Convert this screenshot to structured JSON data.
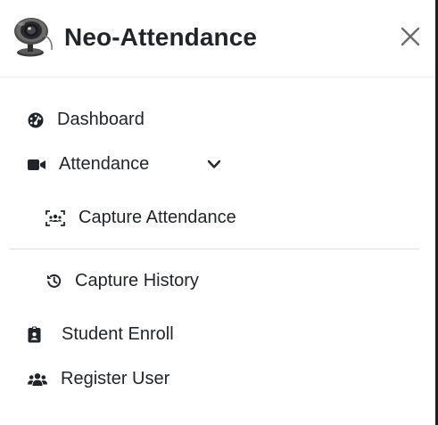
{
  "app": {
    "title": "Neo-Attendance"
  },
  "nav": {
    "dashboard": {
      "label": "Dashboard",
      "icon": "tachometer-icon"
    },
    "attendance": {
      "label": "Attendance",
      "icon": "video-icon",
      "expanded": true
    },
    "capture_attendance": {
      "label": "Capture Attendance",
      "icon": "users-viewfinder-icon"
    },
    "capture_history": {
      "label": "Capture History",
      "icon": "history-icon"
    },
    "student_enroll": {
      "label": "Student Enroll",
      "icon": "id-badge-icon"
    },
    "register_user": {
      "label": "Register User",
      "icon": "users-icon"
    }
  },
  "colors": {
    "text": "#212529",
    "divider": "#dcdcdc",
    "close": "#6c6c6c"
  }
}
